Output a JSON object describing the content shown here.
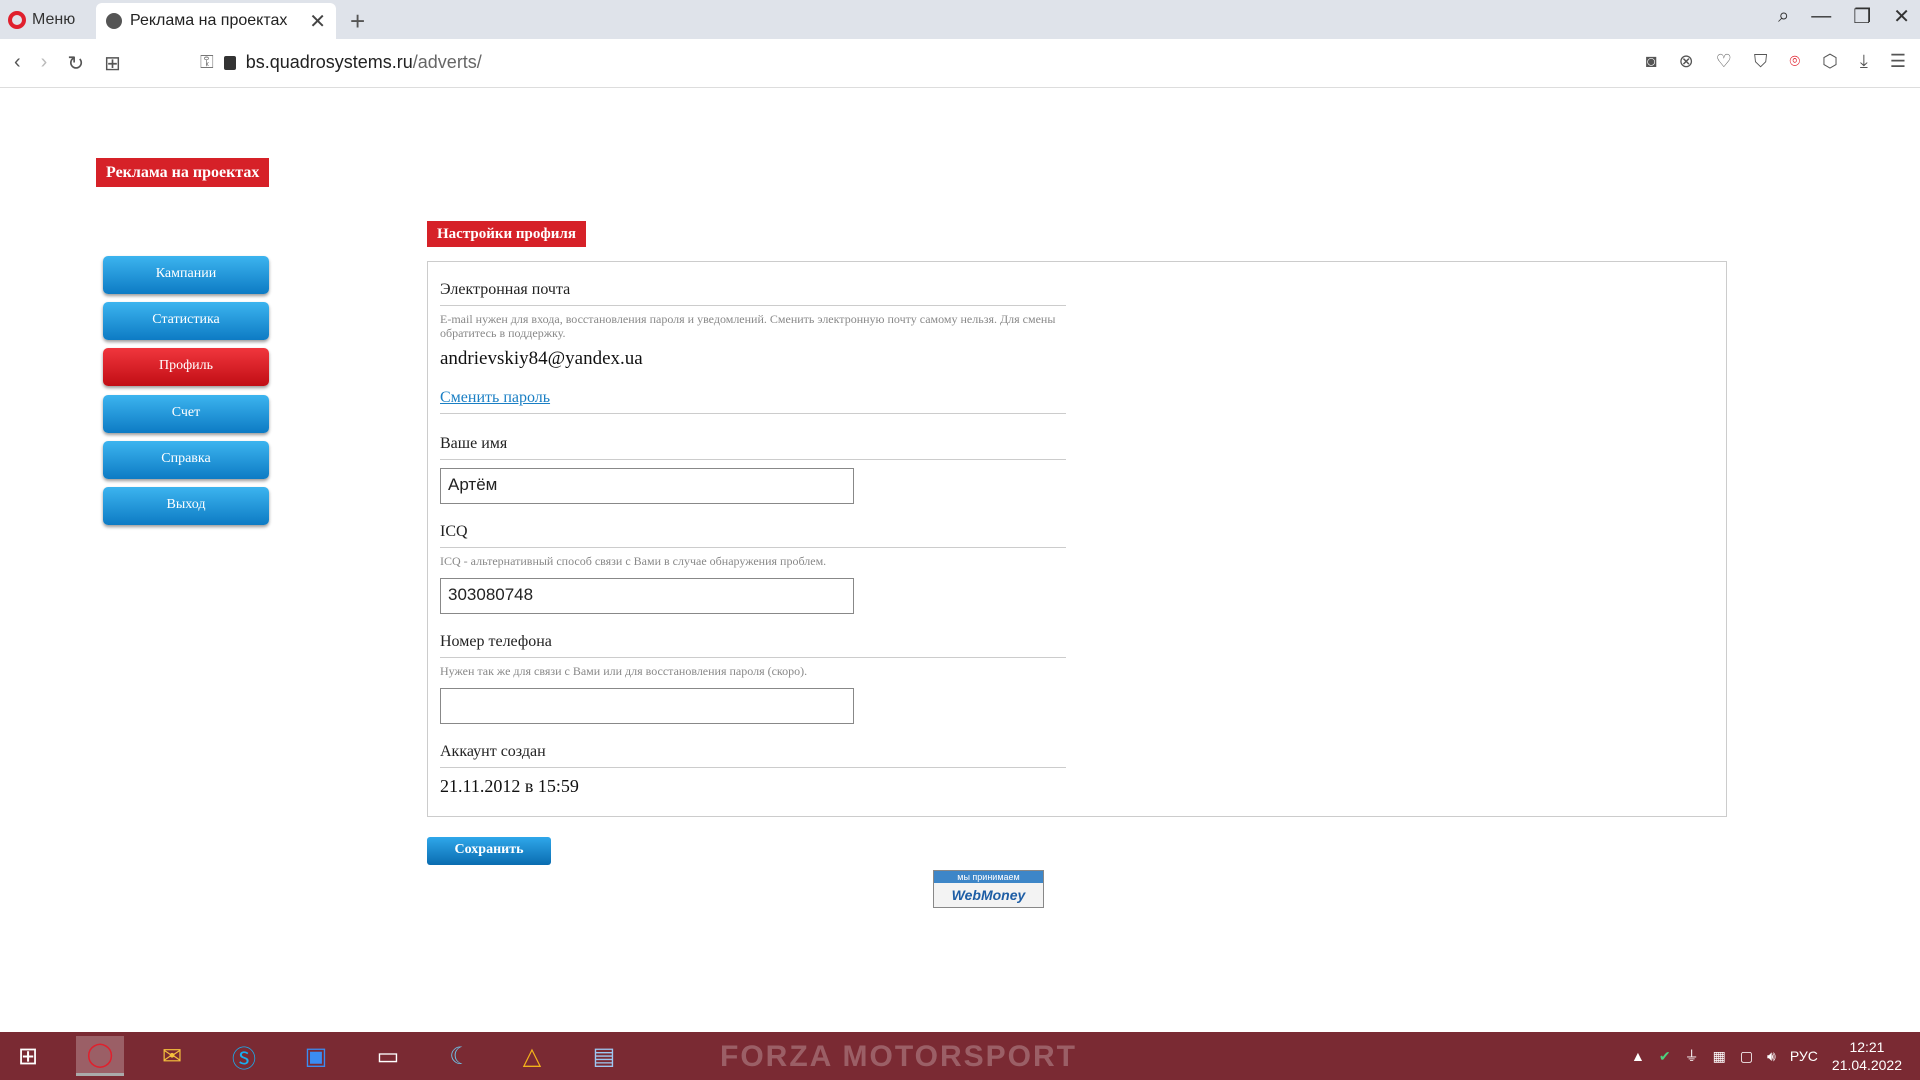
{
  "browser": {
    "menu_label": "Меню",
    "tab_title": "Реклама на проектах",
    "url_host": "bs.quadrosystems.ru",
    "url_path": "/adverts/"
  },
  "site": {
    "label": "Реклама на проектах"
  },
  "sidebar": {
    "items": [
      {
        "label": "Кампании",
        "active": false
      },
      {
        "label": "Статистика",
        "active": false
      },
      {
        "label": "Профиль",
        "active": true
      },
      {
        "label": "Счет",
        "active": false
      },
      {
        "label": "Справка",
        "active": false
      },
      {
        "label": "Выход",
        "active": false
      }
    ]
  },
  "profile": {
    "section_title": "Настройки профиля",
    "email": {
      "label": "Электронная почта",
      "hint": "E-mail нужен для входа, восстановления пароля и уведомлений. Сменить электронную почту самому нельзя. Для смены обратитесь в поддержку.",
      "value": "andrievskiy84@yandex.ua"
    },
    "change_password_link": "Сменить пароль",
    "name": {
      "label": "Ваше имя",
      "value": "Артём"
    },
    "icq": {
      "label": "ICQ",
      "hint": "ICQ - альтернативный способ связи с Вами в случае обнаружения проблем.",
      "value": "303080748"
    },
    "phone": {
      "label": "Номер телефона",
      "hint": "Нужен так же для связи с Вами или для восстановления пароля (скоро).",
      "value": ""
    },
    "created": {
      "label": "Аккаунт создан",
      "value": "21.11.2012 в 15:59"
    },
    "save_label": "Сохранить"
  },
  "webmoney": {
    "top": "мы принимаем",
    "brand": "WebMoney"
  },
  "taskbar": {
    "wallpaper_text": "FORZA MOTORSPORT",
    "lang": "РУС",
    "time": "12:21",
    "date": "21.04.2022"
  }
}
